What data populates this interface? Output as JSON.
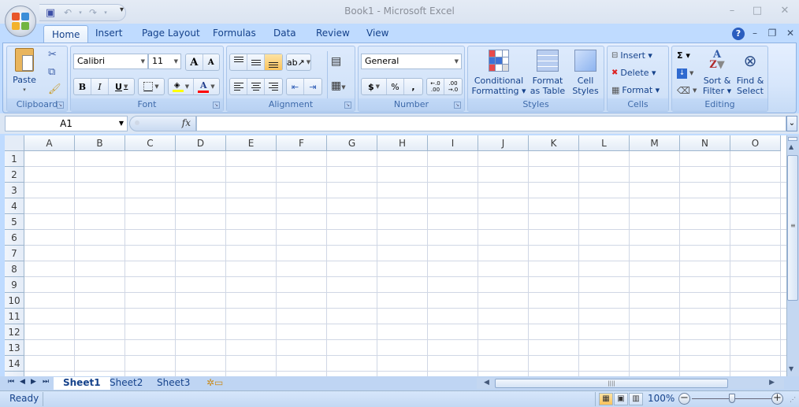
{
  "window": {
    "title": "Book1 - Microsoft Excel"
  },
  "quick_access": {
    "save": "save-icon",
    "undo": "undo-icon",
    "redo": "redo-icon",
    "customize": "▾"
  },
  "window_controls": {
    "minimize": "–",
    "maximize": "□",
    "close": "✕"
  },
  "doc_controls": {
    "help": "?",
    "minimize": "–",
    "restore": "❐",
    "close": "✕"
  },
  "tabs": [
    {
      "label": "Home",
      "active": true
    },
    {
      "label": "Insert"
    },
    {
      "label": "Page Layout"
    },
    {
      "label": "Formulas"
    },
    {
      "label": "Data"
    },
    {
      "label": "Review"
    },
    {
      "label": "View"
    }
  ],
  "ribbon": {
    "clipboard": {
      "label": "Clipboard",
      "paste": "Paste"
    },
    "font": {
      "label": "Font",
      "font_name": "Calibri",
      "font_size": "11",
      "bold": "B",
      "italic": "I",
      "underline": "U",
      "grow": "A",
      "shrink": "A",
      "font_color": "A",
      "highlight_color": "#ffff00",
      "text_color": "#ff0000"
    },
    "alignment": {
      "label": "Alignment"
    },
    "number": {
      "label": "Number",
      "format": "General",
      "currency": "$",
      "percent": "%",
      "comma": ",",
      "inc_decimal": "←.0 .00",
      "dec_decimal": ".00 →.0"
    },
    "styles": {
      "label": "Styles",
      "conditional": [
        "Conditional",
        "Formatting ▾"
      ],
      "format_table": [
        "Format",
        "as Table ▾"
      ],
      "cell_styles": [
        "Cell",
        "Styles ▾"
      ]
    },
    "cells": {
      "label": "Cells",
      "insert": "Insert ▾",
      "delete": "Delete ▾",
      "format": "Format ▾"
    },
    "editing": {
      "label": "Editing",
      "sum": "Σ ▾",
      "sort": [
        "Sort &",
        "Filter ▾"
      ],
      "find": [
        "Find &",
        "Select ▾"
      ]
    }
  },
  "formula_bar": {
    "name_box": "A1",
    "fx": "fx",
    "value": ""
  },
  "columns": [
    "A",
    "B",
    "C",
    "D",
    "E",
    "F",
    "G",
    "H",
    "I",
    "J",
    "K",
    "L",
    "M",
    "N",
    "O"
  ],
  "rows": [
    "1",
    "2",
    "3",
    "4",
    "5",
    "6",
    "7",
    "8",
    "9",
    "10",
    "11",
    "12",
    "13",
    "14"
  ],
  "sheets": [
    {
      "label": "Sheet1",
      "active": true
    },
    {
      "label": "Sheet2"
    },
    {
      "label": "Sheet3"
    }
  ],
  "status": {
    "text": "Ready",
    "zoom": "100%",
    "zoom_level_percent": 100
  }
}
